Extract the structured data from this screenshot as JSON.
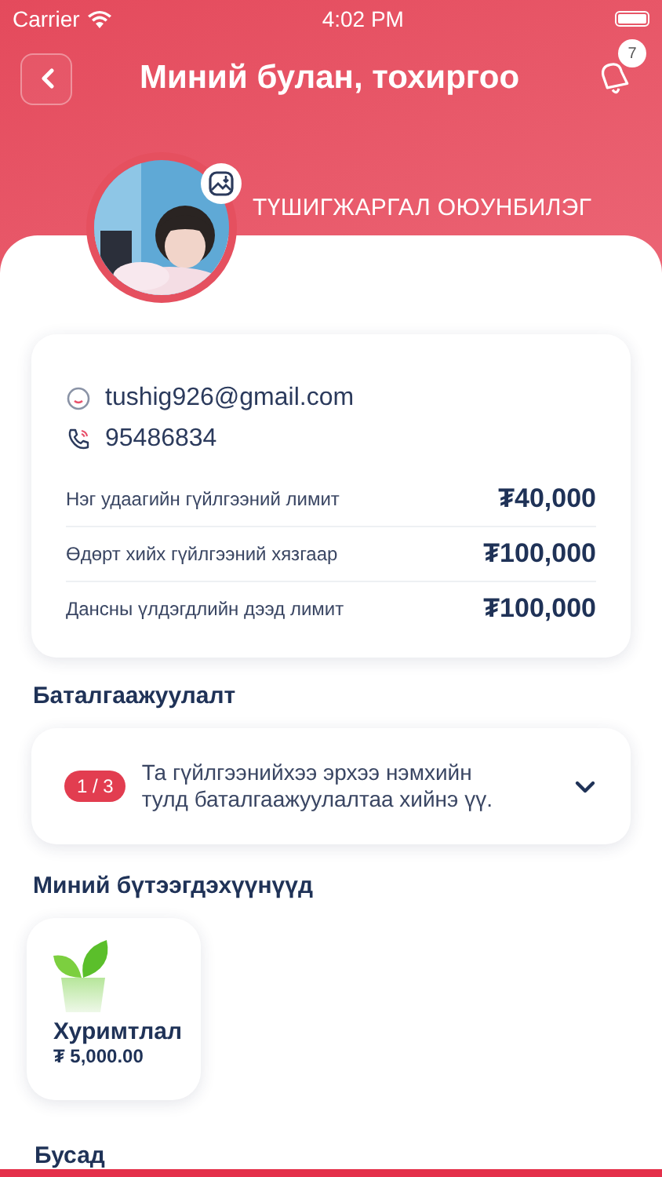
{
  "status_bar": {
    "carrier": "Carrier",
    "time": "4:02 PM"
  },
  "header": {
    "title": "Миний булан, тохиргоо",
    "notification_count": "7"
  },
  "profile": {
    "name": "ТҮШИГЖАРГАЛ ОЮУНБИЛЭГ"
  },
  "contact": {
    "email": "tushig926@gmail.com",
    "phone": "95486834"
  },
  "limits": [
    {
      "label": "Нэг удаагийн гүйлгээний лимит",
      "value": "₮40,000"
    },
    {
      "label": "Өдөрт хийх гүйлгээний хязгаар",
      "value": "₮100,000"
    },
    {
      "label": "Дансны үлдэгдлийн дээд лимит",
      "value": "₮100,000"
    }
  ],
  "verification": {
    "title": "Баталгаажуулалт",
    "step": "1 / 3",
    "message": "Та гүйлгээнийхээ эрхээ нэмхийн тулд баталгаажуулалтаа хийнэ үү.",
    "expanded": false
  },
  "products": {
    "title": "Миний бүтээгдэхүүнүүд",
    "items": [
      {
        "name": "Хуримтлал",
        "amount": "₮ 5,000.00"
      }
    ]
  },
  "other": {
    "title": "Бусад"
  }
}
